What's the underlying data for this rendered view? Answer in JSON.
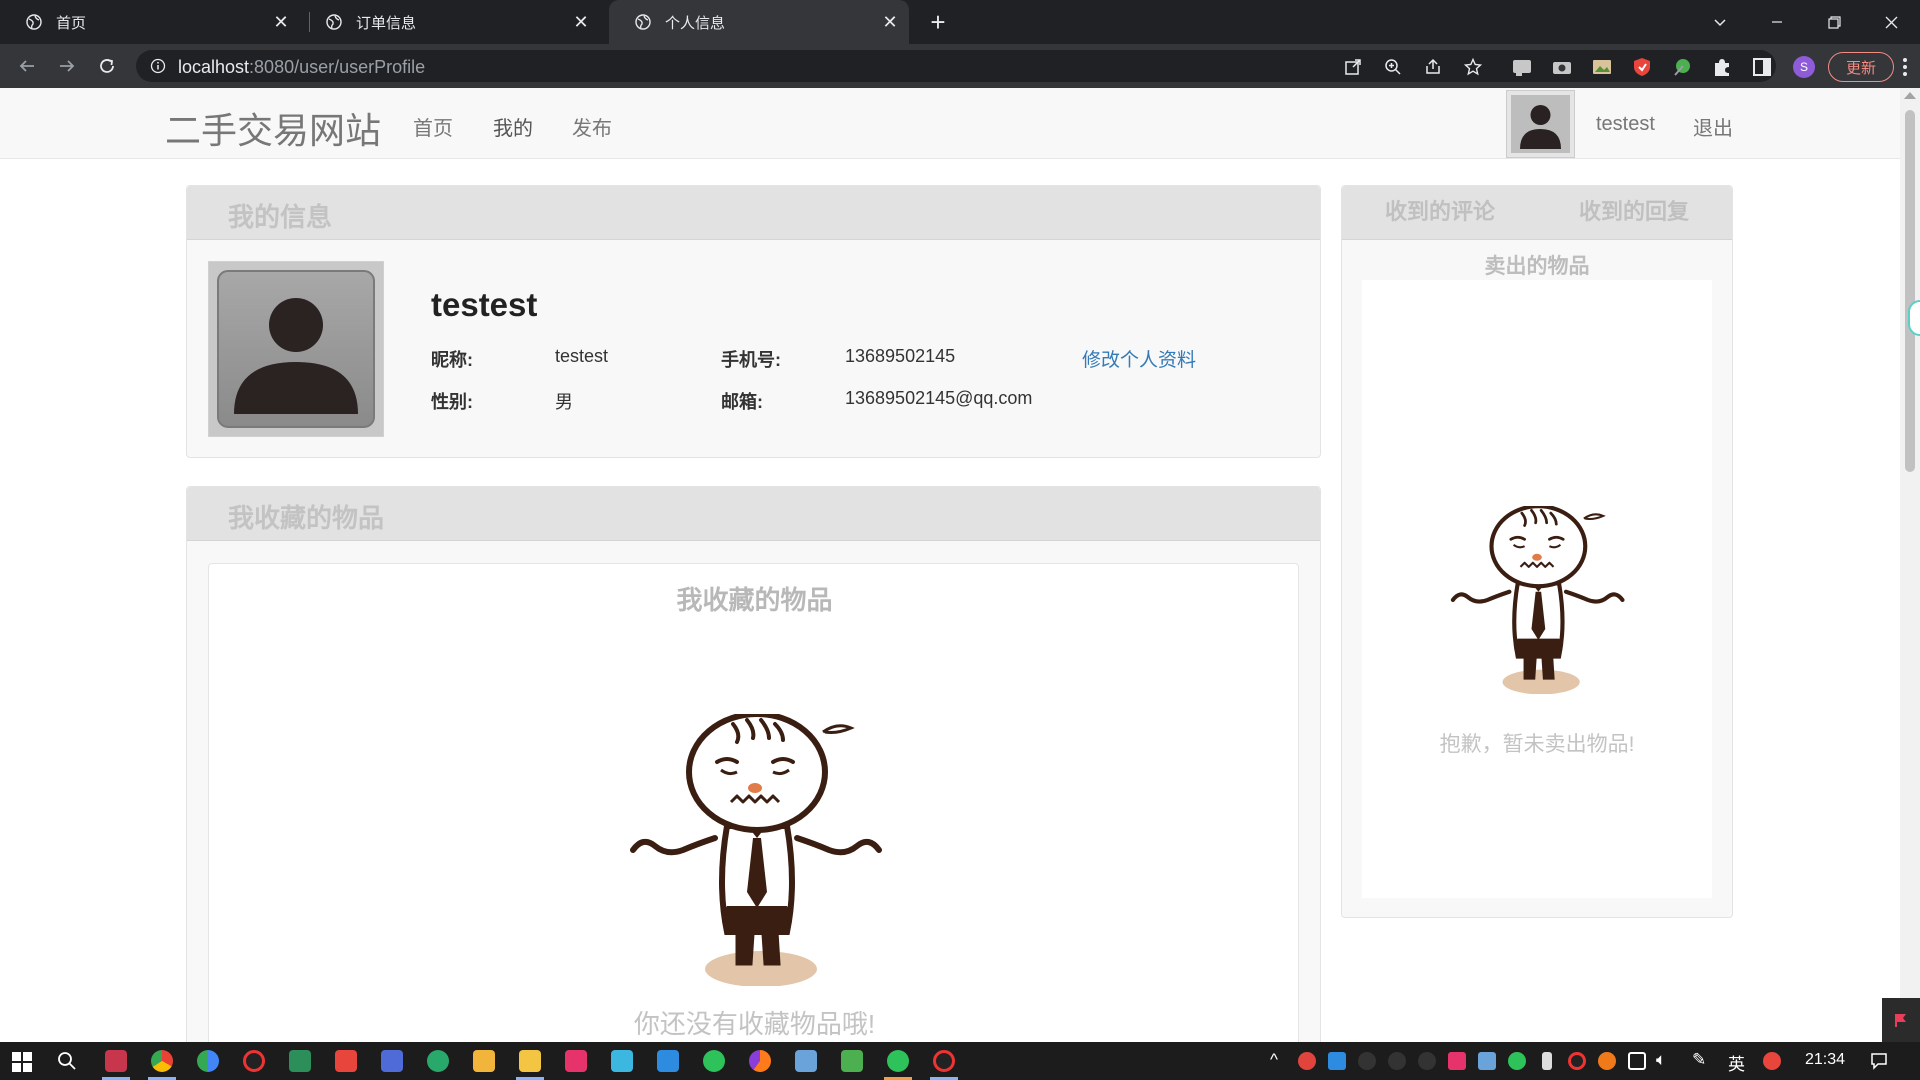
{
  "browser": {
    "tabs": [
      {
        "label": "首页",
        "active": false
      },
      {
        "label": "订单信息",
        "active": false
      },
      {
        "label": "个人信息",
        "active": true
      }
    ],
    "url_host": "localhost",
    "url_path": ":8080/user/userProfile",
    "profile_initial": "S",
    "update_label": "更新"
  },
  "site": {
    "brand": "二手交易网站",
    "nav": [
      "首页",
      "我的",
      "发布"
    ],
    "username": "testest",
    "logout": "退出"
  },
  "profile_panel": {
    "title": "我的信息",
    "name": "testest",
    "fields": {
      "nickname_label": "昵称:",
      "nickname": "testest",
      "phone_label": "手机号:",
      "phone": "13689502145",
      "gender_label": "性别:",
      "gender": "男",
      "email_label": "邮箱:",
      "email": "13689502145@qq.com"
    },
    "edit_link": "修改个人资料"
  },
  "favorites_panel": {
    "title": "我收藏的物品",
    "inner_title": "我收藏的物品",
    "empty_text": "你还没有收藏物品哦!"
  },
  "right_panel": {
    "tabs": [
      "收到的评论",
      "收到的回复"
    ],
    "subtitle": "卖出的物品",
    "empty_text": "抱歉，暂未卖出物品!"
  },
  "taskbar": {
    "ime": "英",
    "time": "21:34"
  },
  "colors": {
    "chrome_dark": "#202124",
    "chrome_toolbar": "#35363a",
    "link": "#337ab7",
    "update_accent": "#f28b82"
  }
}
